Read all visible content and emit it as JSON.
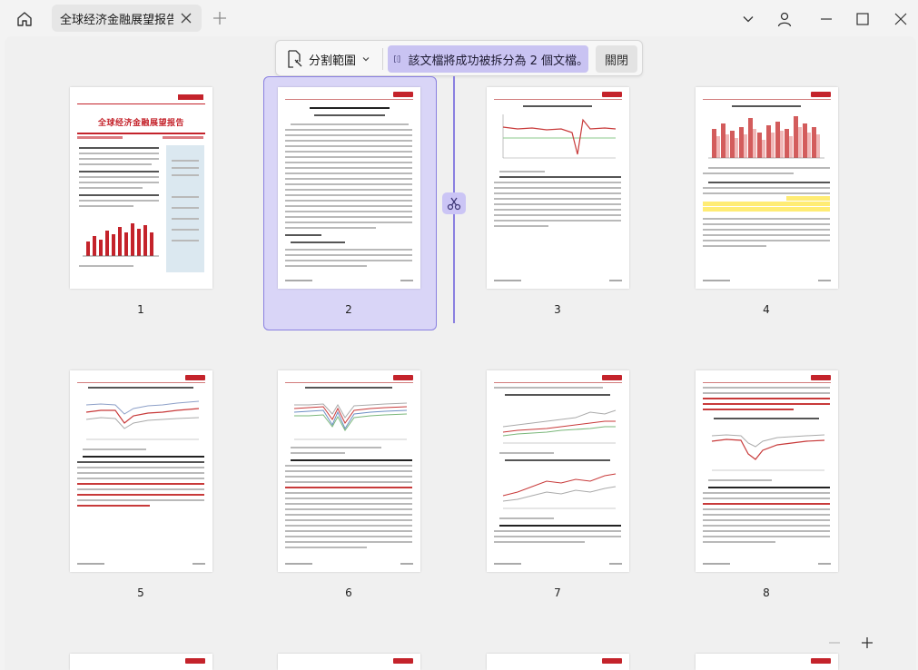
{
  "window": {
    "tab_title": "全球经济金融展望报告",
    "home_icon": "home-icon",
    "icons": [
      "close-icon",
      "plus-icon",
      "chevron-down-icon",
      "user-icon",
      "minimize-icon",
      "maximize-icon"
    ]
  },
  "split_toolbar": {
    "range_label": "分割範圍",
    "status_text": "該文檔將成功被拆分為 2 個文檔。",
    "close_label": "關閉"
  },
  "pages": [
    {
      "number": "1",
      "selected": false
    },
    {
      "number": "2",
      "selected": true
    },
    {
      "number": "3",
      "selected": false
    },
    {
      "number": "4",
      "selected": false
    },
    {
      "number": "5",
      "selected": false
    },
    {
      "number": "6",
      "selected": false
    },
    {
      "number": "7",
      "selected": false
    },
    {
      "number": "8",
      "selected": false
    }
  ],
  "page1": {
    "title": "全球经济金融展望报告",
    "chart_colors": {
      "bar": "#c4232b",
      "header": "#c4232b",
      "sidebar": "#dbe8f0"
    }
  },
  "colors": {
    "accent": "#8a80e0",
    "selection_fill": "#d9d5f7",
    "status_pill": "#c9c3f2",
    "brand_red": "#c4232b",
    "highlight_yellow": "#ffe95c"
  },
  "zoom": {
    "minus_icon": "zoom-out-icon",
    "plus_icon": "zoom-in-icon"
  }
}
